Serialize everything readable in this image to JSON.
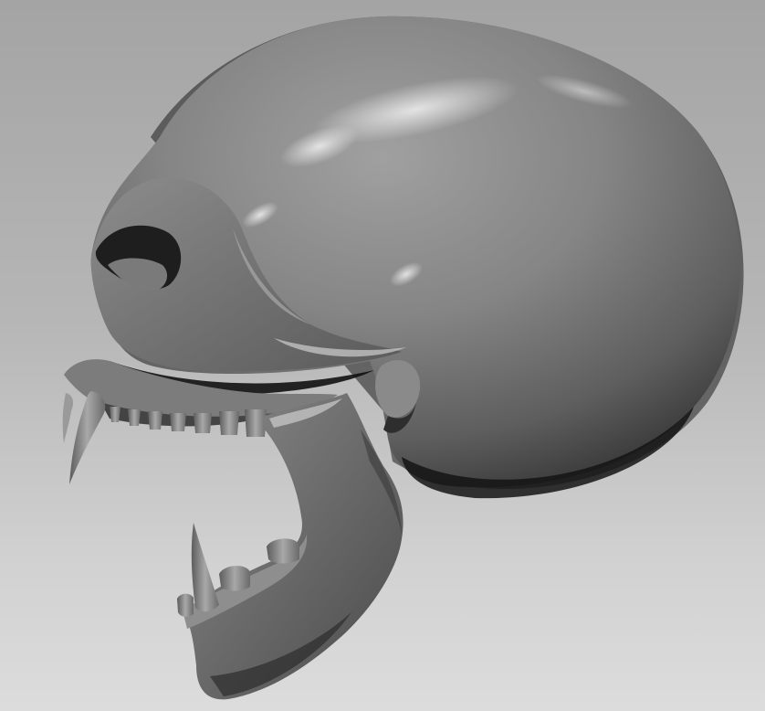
{
  "viewport": {
    "background_top": "#a4a4a4",
    "background_bottom": "#dcdcdc"
  },
  "model": {
    "subject": "skull-icon",
    "material_dark": "#2c2c2c",
    "material_mid": "#6e6e6e",
    "material_light": "#9a9a9a",
    "highlight": "#d8d8d8"
  }
}
